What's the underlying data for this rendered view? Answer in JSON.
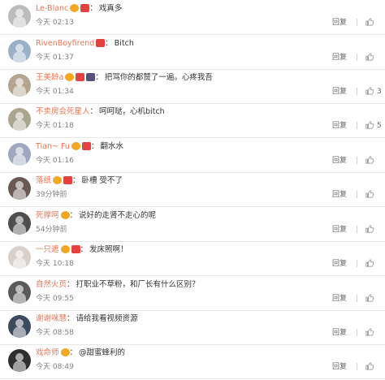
{
  "comments": [
    {
      "name": "Le-Blanc",
      "badges": [
        "gold",
        "red"
      ],
      "text": "戏真多",
      "time": "今天 02:13",
      "likes": "",
      "reply": "回复",
      "avatar_color": "#bcbcbc"
    },
    {
      "name": "RivenBoyfirend",
      "badges": [
        "red"
      ],
      "text": "Bitch",
      "time": "今天 01:37",
      "likes": "",
      "reply": "回复",
      "avatar_color": "#9ab0c8"
    },
    {
      "name": "王美龄a",
      "badges": [
        "gold",
        "red",
        "dark"
      ],
      "text": "把骂你的都赞了一遍。心疼我吾",
      "time": "今天 01:34",
      "likes": "3",
      "reply": "回复",
      "avatar_color": "#b3a590"
    },
    {
      "name": "不卖房会死星人",
      "badges": [],
      "text": "呵呵哒，心机bitch",
      "time": "今天 01:18",
      "likes": "5",
      "reply": "回复",
      "avatar_color": "#a9a58f"
    },
    {
      "name": "Tian~ Fu",
      "badges": [
        "gold",
        "red"
      ],
      "text": "翻水水",
      "time": "今天 01:16",
      "likes": "",
      "reply": "回复",
      "avatar_color": "#9fa8c0"
    },
    {
      "name": "落纸",
      "badges": [
        "gold",
        "red"
      ],
      "text": "卧槽 受不了",
      "time": "39分钟前",
      "likes": "",
      "reply": "回复",
      "avatar_color": "#6a5a55"
    },
    {
      "name": "死撑呵",
      "badges": [
        "gold"
      ],
      "text": "说好的走肾不走心的呢",
      "time": "54分钟前",
      "likes": "",
      "reply": "回复",
      "avatar_color": "#4e4e4e"
    },
    {
      "name": "一只遮",
      "badges": [
        "gold",
        "red"
      ],
      "text": "发床照啊！",
      "time": "今天 10:18",
      "likes": "",
      "reply": "回复",
      "avatar_color": "#d8cfc8"
    },
    {
      "name": "自然火页",
      "badges": [],
      "text": "打职业不草粉，和厂长有什么区别？",
      "time": "今天 09:55",
      "likes": "",
      "reply": "回复",
      "avatar_color": "#5a5a5a"
    },
    {
      "name": "谢谢咪慧",
      "badges": [],
      "text": "请给我看视频资源",
      "time": "今天 08:58",
      "likes": "",
      "reply": "回复",
      "avatar_color": "#3d4a5e"
    },
    {
      "name": "戏命师",
      "badges": [
        "gold"
      ],
      "text": "@甜蜜蜂利的",
      "time": "今天 08:49",
      "likes": "",
      "reply": "回复",
      "avatar_color": "#2f2f2f"
    }
  ],
  "colors": {
    "username": "#eb7350",
    "text": "#333333",
    "meta": "#808080",
    "divider": "#e6e6e6"
  },
  "icons": {
    "like": "thumbs-up-icon"
  }
}
